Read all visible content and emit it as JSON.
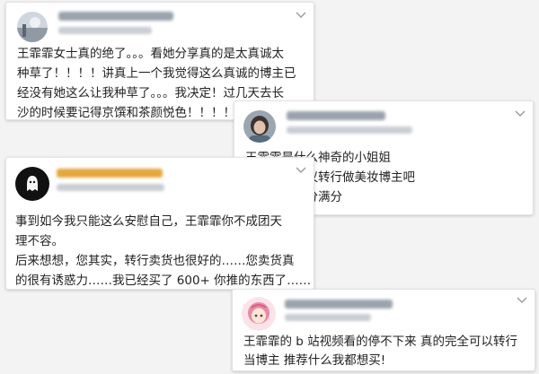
{
  "posts": [
    {
      "avatar_icon": "scenery-avatar-icon",
      "text": "王霏霏女士真的绝了。。。看她分享真的是太真诚太\n种草了！！！！讲真上一个我觉得这么真诚的博主已\n经没有她这么让我种草了。。。我决定！过几天去长\n沙的时候要记得京馔和茶颜悦色！！！！"
    },
    {
      "avatar_icon": "person-photo-avatar-icon",
      "text": "王霏霏是什么神奇的小姐姐\n不成团也建议转行做美妆博主吧\n带货能力满分满分"
    },
    {
      "avatar_icon": "ghost-avatar-icon",
      "text": "事到如今我只能这么安慰自己，王霏霏你不成团天\n理不容。\n后来想想，您其实，转行卖货也很好的……您卖货真\n的很有诱惑力……我已经买了 600+ 你推的东西了……"
    },
    {
      "avatar_icon": "anime-girl-avatar-icon",
      "text": "王霏霏的 b 站视频看的停不下来 真的完全可以转行\n当博主 推荐什么我都想买!"
    }
  ],
  "colors": {
    "text": "#222222",
    "card_bg": "#ffffff",
    "page_bg": "#f3f3f3",
    "blur_name": "#9aa3ad"
  }
}
